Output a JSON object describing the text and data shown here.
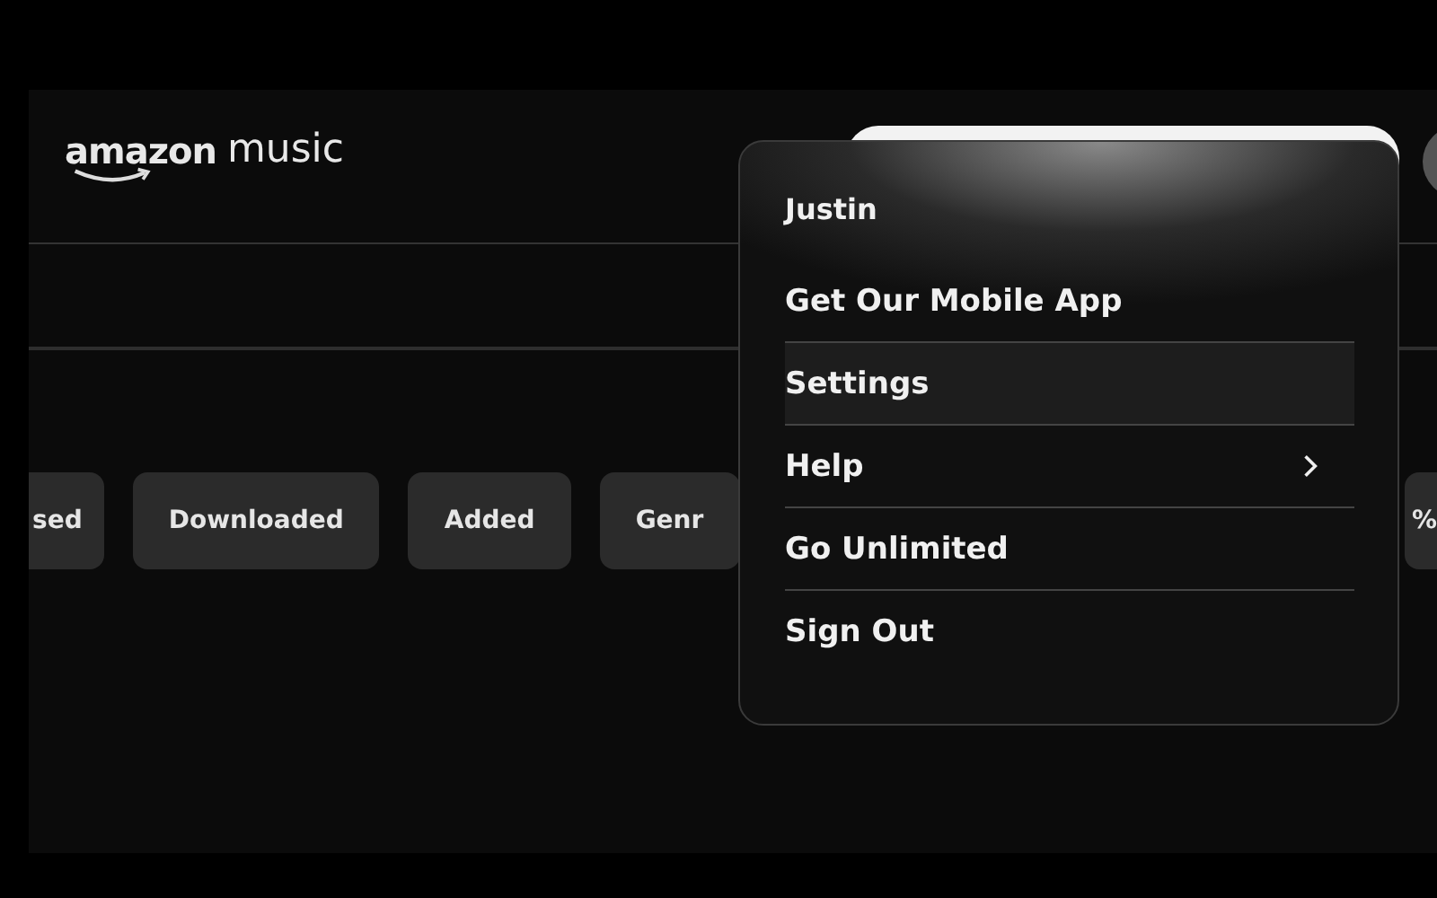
{
  "header": {
    "logo": {
      "brand": "amazon",
      "product": "music"
    },
    "search": {
      "kind": "field"
    }
  },
  "filters": [
    {
      "label": "sed"
    },
    {
      "label": "Downloaded"
    },
    {
      "label": "Added"
    },
    {
      "label": "Genr"
    },
    {
      "label": "%"
    }
  ],
  "account_menu": {
    "user": "Justin",
    "items": [
      {
        "label": "Get Our Mobile App",
        "selected": false,
        "has_submenu": false
      },
      {
        "label": "Settings",
        "selected": true,
        "has_submenu": false
      },
      {
        "label": "Help",
        "selected": false,
        "has_submenu": true
      },
      {
        "label": "Go Unlimited",
        "selected": false,
        "has_submenu": false
      },
      {
        "label": "Sign Out",
        "selected": false,
        "has_submenu": false
      }
    ]
  }
}
